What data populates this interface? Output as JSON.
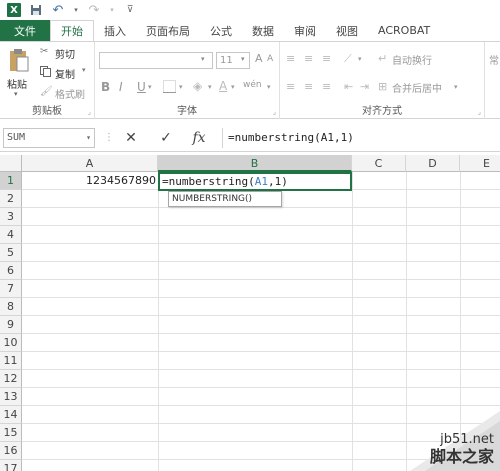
{
  "tabs": [
    "文件",
    "开始",
    "插入",
    "页面布局",
    "公式",
    "数据",
    "审阅",
    "视图",
    "ACROBAT"
  ],
  "ribbon": {
    "clipboard": {
      "paste": "粘贴",
      "cut": "剪切",
      "copy": "复制",
      "format_painter": "格式刷",
      "label": "剪贴板"
    },
    "font": {
      "font_size": "11",
      "bold": "B",
      "italic": "I",
      "underline": "U",
      "grow": "A",
      "shrink": "A",
      "font_color": "A",
      "phonetic": "wén",
      "label": "字体"
    },
    "alignment": {
      "wrap": "自动换行",
      "merge": "合并后居中",
      "label": "对齐方式"
    },
    "number": {
      "format": "常"
    }
  },
  "formula_bar": {
    "name_box": "SUM",
    "cancel": "✕",
    "enter": "✓",
    "fx": "fx",
    "formula": "=numberstring(A1,1)"
  },
  "grid": {
    "columns": [
      "A",
      "B",
      "C",
      "D",
      "E"
    ],
    "rows": [
      "1",
      "2",
      "3",
      "4",
      "5",
      "6",
      "7",
      "8",
      "9",
      "10",
      "11",
      "12",
      "13",
      "14",
      "15",
      "16",
      "17"
    ],
    "cells": {
      "A1": "1234567890",
      "B1_prefix": "=numberstring(",
      "B1_ref": "A1",
      "B1_suffix": ",1)"
    },
    "tooltip": "NUMBERSTRING()"
  },
  "watermark": {
    "site": "jb51.net",
    "brand": "脚本之家"
  }
}
